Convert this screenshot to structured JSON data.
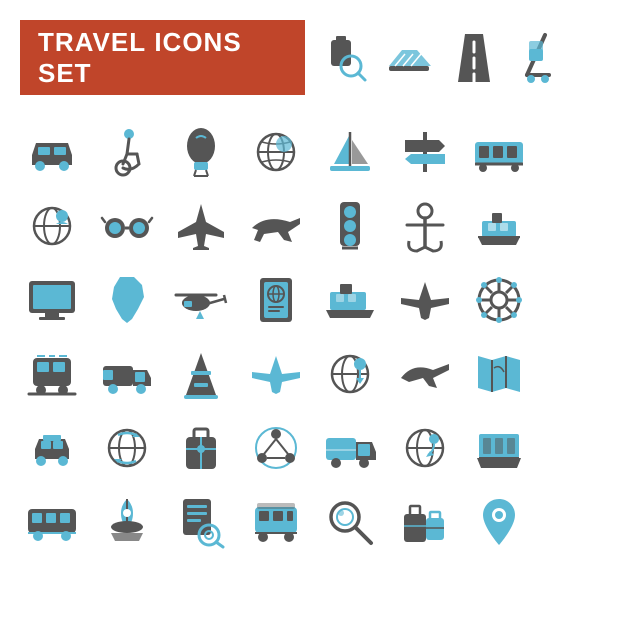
{
  "title": {
    "word1": "TRAVEL",
    "word2": "ICONS SET"
  },
  "colors": {
    "orange": "#c0452a",
    "blue": "#5bb8d4",
    "dark": "#555555",
    "white": "#ffffff"
  },
  "icons": [
    {
      "name": "luggage-search",
      "row": 0,
      "col": 4
    },
    {
      "name": "escalator",
      "row": 0,
      "col": 5
    },
    {
      "name": "road",
      "row": 0,
      "col": 6
    },
    {
      "name": "hand-truck",
      "row": 0,
      "col": 7
    }
  ]
}
